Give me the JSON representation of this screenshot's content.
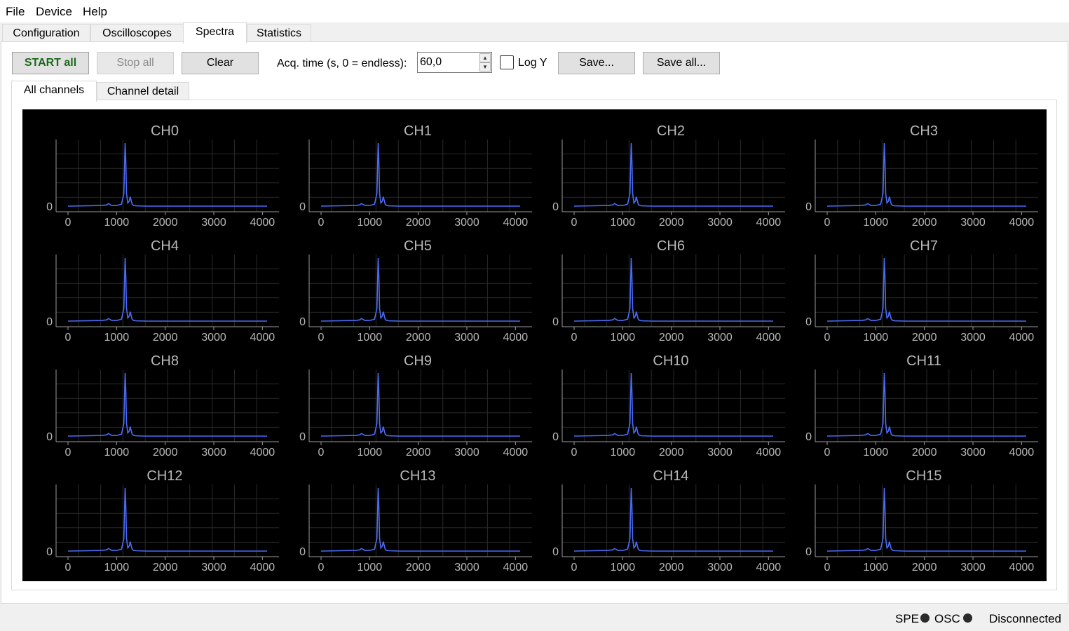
{
  "menu": {
    "file": "File",
    "device": "Device",
    "help": "Help"
  },
  "tabs": [
    "Configuration",
    "Oscilloscopes",
    "Spectra",
    "Statistics"
  ],
  "active_tab": "Spectra",
  "toolbar": {
    "start_all": "START all",
    "stop_all": "Stop all",
    "clear": "Clear",
    "acq_label": "Acq. time (s, 0 = endless):",
    "acq_value": "60,0",
    "log_y_label": "Log Y",
    "log_y_checked": false,
    "save": "Save...",
    "save_all": "Save all..."
  },
  "subtabs": [
    "All channels",
    "Channel detail"
  ],
  "active_subtab": "All channels",
  "status": {
    "spe": "SPE",
    "osc": "OSC",
    "connection": "Disconnected"
  },
  "colors": {
    "trace": "#4a6cf7",
    "plot_bg": "#000000",
    "axis": "#9a9a9a",
    "grid": "#2a2a2a",
    "start_text": "#1a6a1a"
  },
  "chart_data": {
    "type": "line",
    "layout": "grid-4x4",
    "x_ticks": [
      0,
      1000,
      2000,
      3000,
      4000
    ],
    "x_range": [
      0,
      4096
    ],
    "y_tick_labels": [
      "0"
    ],
    "panels": [
      "CH0",
      "CH1",
      "CH2",
      "CH3",
      "CH4",
      "CH5",
      "CH6",
      "CH7",
      "CH8",
      "CH9",
      "CH10",
      "CH11",
      "CH12",
      "CH13",
      "CH14",
      "CH15"
    ],
    "series_shape": {
      "x": [
        0,
        700,
        800,
        830,
        860,
        900,
        1000,
        1100,
        1150,
        1175,
        1190,
        1205,
        1230,
        1260,
        1280,
        1300,
        1320,
        1350,
        1400,
        1600,
        2000,
        4096
      ],
      "y": [
        0,
        0.01,
        0.02,
        0.04,
        0.03,
        0.01,
        0.01,
        0.03,
        0.2,
        1.0,
        0.7,
        0.2,
        0.05,
        0.08,
        0.15,
        0.09,
        0.03,
        0.01,
        0.005,
        0.0,
        0.0,
        0.0
      ]
    }
  }
}
